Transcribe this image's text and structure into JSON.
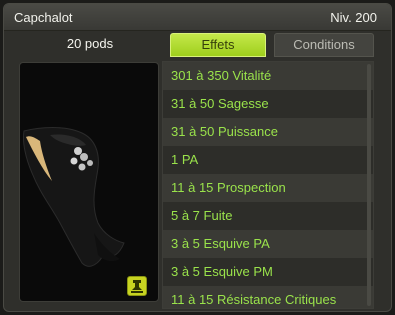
{
  "header": {
    "item_name": "Capchalot",
    "level": "Niv. 200"
  },
  "item": {
    "weight": "20 pods",
    "set_icon": "set-bonus-icon"
  },
  "tabs": [
    {
      "label": "Effets",
      "active": true
    },
    {
      "label": "Conditions",
      "active": false
    }
  ],
  "effects": [
    "301 à 350 Vitalité",
    "31 à 50 Sagesse",
    "31 à 50 Puissance",
    "1 PA",
    "11 à 15 Prospection",
    "5 à 7 Fuite",
    "3 à 5 Esquive PA",
    "3 à 5 Esquive PM",
    "11 à 15 Résistance Critiques"
  ],
  "colors": {
    "effect_text": "#9ae34b",
    "active_tab": "#b3dd2e"
  }
}
